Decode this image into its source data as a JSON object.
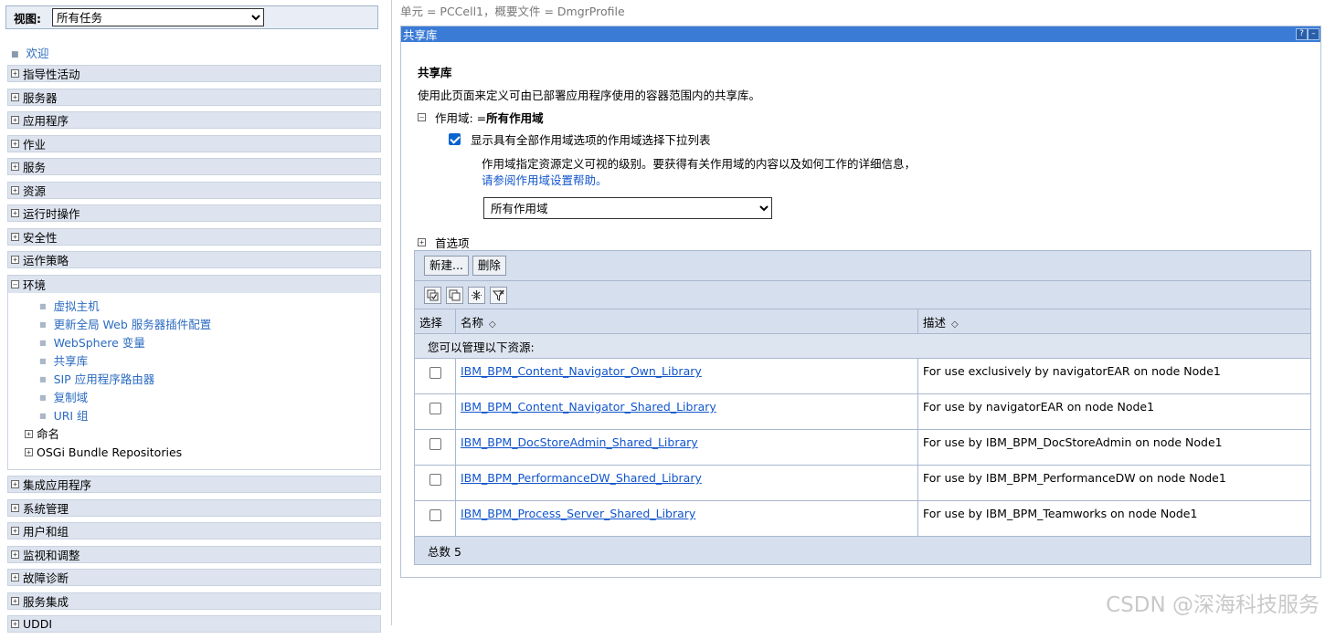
{
  "nav": {
    "view_label": "视图:",
    "view_value": "所有任务",
    "welcome": "欢迎",
    "categories_top": [
      "指导性活动",
      "服务器",
      "应用程序",
      "作业",
      "服务",
      "资源",
      "运行时操作",
      "安全性",
      "运作策略"
    ],
    "environment": {
      "label": "环境",
      "items": [
        "虚拟主机",
        "更新全局 Web 服务器插件配置",
        "WebSphere 变量",
        "共享库",
        "SIP 应用程序路由器",
        "复制域",
        "URI 组"
      ],
      "subgroups": [
        "命名",
        "OSGi Bundle Repositories"
      ]
    },
    "categories_bottom": [
      "集成应用程序",
      "系统管理",
      "用户和组",
      "监视和调整",
      "故障诊断",
      "服务集成",
      "UDDI"
    ]
  },
  "main": {
    "breadcrumb": "单元 = PCCell1，概要文件 = DmgrProfile",
    "panel_title": "共享库",
    "help_icon": "?",
    "min_icon": "–",
    "heading": "共享库",
    "description": "使用此页面来定义可由已部署应用程序使用的容器范围内的共享库。",
    "scope_label": "作用域: =",
    "scope_value": "所有作用域",
    "show_scope_checkbox": "显示具有全部作用域选项的作用域选择下拉列表",
    "scope_help_text": "作用域指定资源定义可视的级别。要获得有关作用域的内容以及如何工作的详细信息，",
    "scope_help_link": "请参阅作用域设置帮助。",
    "scope_select_value": "所有作用域",
    "preferences": "首选项",
    "buttons": {
      "new": "新建...",
      "delete": "删除"
    },
    "icons": [
      "select-all-icon",
      "deselect-all-icon",
      "show-filter-icon",
      "clear-filter-icon"
    ],
    "table": {
      "col_select": "选择",
      "col_name": "名称",
      "col_desc": "描述",
      "sort_glyph": "◇",
      "group_label": "您可以管理以下资源:",
      "rows": [
        {
          "name": "IBM_BPM_Content_Navigator_Own_Library",
          "desc": "For use exclusively by navigatorEAR on node Node1"
        },
        {
          "name": "IBM_BPM_Content_Navigator_Shared_Library",
          "desc": "For use by navigatorEAR on node Node1"
        },
        {
          "name": "IBM_BPM_DocStoreAdmin_Shared_Library",
          "desc": "For use by IBM_BPM_DocStoreAdmin on node Node1"
        },
        {
          "name": "IBM_BPM_PerformanceDW_Shared_Library",
          "desc": "For use by IBM_BPM_PerformanceDW on node Node1"
        },
        {
          "name": "IBM_BPM_Process_Server_Shared_Library",
          "desc": "For use by IBM_BPM_Teamworks on node Node1"
        }
      ],
      "total_label": "总数 5"
    }
  },
  "watermark": "CSDN @深海科技服务"
}
